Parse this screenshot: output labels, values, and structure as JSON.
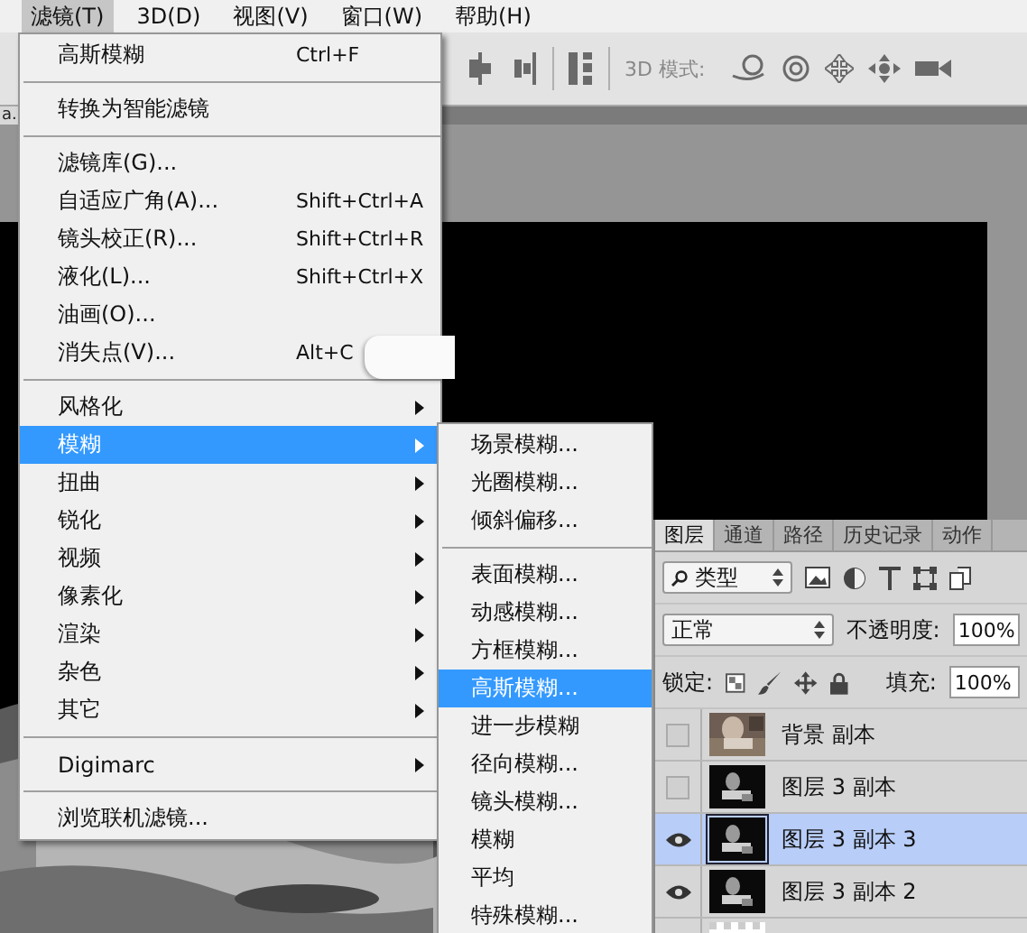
{
  "menubar": [
    {
      "label": "滤镜(T)",
      "selected": true
    },
    {
      "label": "3D(D)",
      "selected": false
    },
    {
      "label": "视图(V)",
      "selected": false
    },
    {
      "label": "窗口(W)",
      "selected": false
    },
    {
      "label": "帮助(H)",
      "selected": false
    }
  ],
  "doc_tab": {
    "title": "a."
  },
  "options_bar": {
    "label": "3D 模式:"
  },
  "filter_menu": {
    "items": [
      {
        "kind": "item",
        "label": "高斯模糊",
        "shortcut": "Ctrl+F",
        "selected": false
      },
      {
        "kind": "separator"
      },
      {
        "kind": "item",
        "label": "转换为智能滤镜",
        "selected": false
      },
      {
        "kind": "separator"
      },
      {
        "kind": "item",
        "label": "滤镜库(G)...",
        "selected": false
      },
      {
        "kind": "item",
        "label": "自适应广角(A)...",
        "shortcut": "Shift+Ctrl+A",
        "selected": false
      },
      {
        "kind": "item",
        "label": "镜头校正(R)...",
        "shortcut": "Shift+Ctrl+R",
        "selected": false
      },
      {
        "kind": "item",
        "label": "液化(L)...",
        "shortcut": "Shift+Ctrl+X",
        "selected": false
      },
      {
        "kind": "item",
        "label": "油画(O)...",
        "selected": false
      },
      {
        "kind": "item",
        "label": "消失点(V)...",
        "shortcut": "Alt+C",
        "selected": false
      },
      {
        "kind": "separator"
      },
      {
        "kind": "submenu",
        "label": "风格化",
        "selected": false
      },
      {
        "kind": "submenu",
        "label": "模糊",
        "selected": true
      },
      {
        "kind": "submenu",
        "label": "扭曲",
        "selected": false
      },
      {
        "kind": "submenu",
        "label": "锐化",
        "selected": false
      },
      {
        "kind": "submenu",
        "label": "视频",
        "selected": false
      },
      {
        "kind": "submenu",
        "label": "像素化",
        "selected": false
      },
      {
        "kind": "submenu",
        "label": "渲染",
        "selected": false
      },
      {
        "kind": "submenu",
        "label": "杂色",
        "selected": false
      },
      {
        "kind": "submenu",
        "label": "其它",
        "selected": false
      },
      {
        "kind": "separator"
      },
      {
        "kind": "submenu",
        "label": "Digimarc",
        "selected": false
      },
      {
        "kind": "separator"
      },
      {
        "kind": "item",
        "label": "浏览联机滤镜...",
        "selected": false
      }
    ]
  },
  "blur_submenu": {
    "items": [
      {
        "kind": "item",
        "label": "场景模糊...",
        "selected": false
      },
      {
        "kind": "item",
        "label": "光圈模糊...",
        "selected": false
      },
      {
        "kind": "item",
        "label": "倾斜偏移...",
        "selected": false
      },
      {
        "kind": "separator"
      },
      {
        "kind": "item",
        "label": "表面模糊...",
        "selected": false
      },
      {
        "kind": "item",
        "label": "动感模糊...",
        "selected": false
      },
      {
        "kind": "item",
        "label": "方框模糊...",
        "selected": false
      },
      {
        "kind": "item",
        "label": "高斯模糊...",
        "selected": true
      },
      {
        "kind": "item",
        "label": "进一步模糊",
        "selected": false
      },
      {
        "kind": "item",
        "label": "径向模糊...",
        "selected": false
      },
      {
        "kind": "item",
        "label": "镜头模糊...",
        "selected": false
      },
      {
        "kind": "item",
        "label": "模糊",
        "selected": false
      },
      {
        "kind": "item",
        "label": "平均",
        "selected": false
      },
      {
        "kind": "item",
        "label": "特殊模糊...",
        "selected": false
      }
    ]
  },
  "layers_panel": {
    "tabs": [
      {
        "label": "图层",
        "selected": true
      },
      {
        "label": "通道",
        "selected": false
      },
      {
        "label": "路径",
        "selected": false
      },
      {
        "label": "历史记录",
        "selected": false
      },
      {
        "label": "动作",
        "selected": false
      }
    ],
    "filter": {
      "value": "类型"
    },
    "blend_mode": {
      "value": "正常"
    },
    "opacity": {
      "label": "不透明度:",
      "value": "100%"
    },
    "lock": {
      "label": "锁定:"
    },
    "fill": {
      "label": "填充:",
      "value": "100%"
    },
    "layers": [
      {
        "name": "背景 副本",
        "visible": false,
        "selected": false
      },
      {
        "kind": "dark",
        "name": "图层 3 副本",
        "visible": false,
        "selected": false
      },
      {
        "kind": "dark",
        "name": "图层 3 副本 3",
        "visible": true,
        "selected": true
      },
      {
        "kind": "dark",
        "name": "图层 3 副本 2",
        "visible": true,
        "selected": false
      },
      {
        "kind": "transparent"
      }
    ]
  }
}
